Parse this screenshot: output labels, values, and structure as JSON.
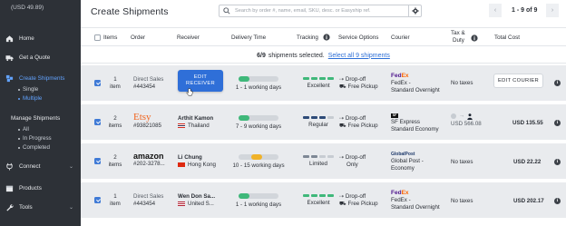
{
  "sidebar": {
    "balance": "(USD 49.89)",
    "items": [
      {
        "label": "Home"
      },
      {
        "label": "Get a Quote"
      },
      {
        "label": "Create Shipments"
      },
      {
        "label": "Manage Shipments"
      },
      {
        "label": "Connect"
      },
      {
        "label": "Products"
      },
      {
        "label": "Tools"
      }
    ],
    "create_sub": [
      "Single",
      "Multiple"
    ],
    "manage_sub": [
      "All",
      "In Progress",
      "Completed"
    ]
  },
  "header": {
    "title": "Create Shipments",
    "search_placeholder": "Search by order #, name, email, SKU, desc. or Easyship ref.",
    "pagination": "1 - 9 of 9",
    "prev": "‹",
    "next": "›"
  },
  "table": {
    "columns": [
      "Items",
      "Order",
      "Receiver",
      "Delivery Time",
      "Tracking",
      "Service Options",
      "Courier",
      "Tax &",
      "Duty",
      "Total Cost"
    ]
  },
  "selection": {
    "count": "6/9",
    "text": "shipments selected.",
    "link": "Select all 9 shipments"
  },
  "colors": {
    "accent": "#2f6fd8",
    "progress_green": "#3fb87a",
    "progress_orange": "#f0b229",
    "tracking_excellent": "#3fb87a",
    "tracking_regular": "#2e4b78",
    "tracking_limited": "#7e8895",
    "tracking_off": "#c7ccd2"
  },
  "rows": [
    {
      "checked": true,
      "items_num": "1",
      "items_word": "item",
      "store": "Direct Sales",
      "order_no": "#443454",
      "receiver_button": [
        "EDIT",
        "RECEIVER"
      ],
      "delivery_progress": 0.27,
      "delivery_color": "#3fb87a",
      "delivery_text": "1 - 1 working days",
      "tracking_level": 4,
      "tracking_color": "#3fb87a",
      "tracking_text": "Excellent",
      "service_1": "Drop-off",
      "service_2": "Free Pickup",
      "courier_logo": "FedEx",
      "courier_line1": "FedEx -",
      "courier_line2": "Standard Overnight",
      "tax": "No taxes",
      "action_label": "EDIT COURIER"
    },
    {
      "checked": true,
      "items_num": "2",
      "items_word": "items",
      "store": "Etsy",
      "order_no": "#93821085",
      "receiver_name": "Arthit Kamon",
      "receiver_country": "Thailand",
      "delivery_progress": 0.27,
      "delivery_color": "#3fb87a",
      "delivery_text": "7 - 9 working days",
      "tracking_level": 3,
      "tracking_color": "#2e4b78",
      "tracking_text": "Regular",
      "service_1": "Drop-off",
      "service_2": "Free Pickup",
      "courier_logo": "SF",
      "courier_line1": "SF Express",
      "courier_line2": "Standard Economy",
      "tax_amount": "USD 566.08",
      "cost": "USD 135.55"
    },
    {
      "checked": true,
      "items_num": "2",
      "items_word": "items",
      "store": "amazon",
      "order_no": "#202-3278...",
      "receiver_name": "Li Chung",
      "receiver_country": "Hong Kong",
      "delivery_progress": 0.27,
      "delivery_color": "#f0b229",
      "delivery_text": "10 - 15 working days",
      "tracking_level": 2,
      "tracking_color": "#7e8895",
      "tracking_text": "Limited",
      "service_1": "Drop-off",
      "service_2": "Only",
      "courier_logo": "GlobalPost",
      "courier_line1": "Global Post -",
      "courier_line2": "Economy",
      "tax": "No taxes",
      "cost": "USD 22.22"
    },
    {
      "checked": true,
      "items_num": "1",
      "items_word": "item",
      "store": "Direct Sales",
      "order_no": "#443454",
      "receiver_name": "Wen Don Sa...",
      "receiver_country": "United S...",
      "delivery_progress": 0.27,
      "delivery_color": "#3fb87a",
      "delivery_text": "1 - 1 working days",
      "tracking_level": 4,
      "tracking_color": "#3fb87a",
      "tracking_text": "Excellent",
      "service_1": "Drop-off",
      "service_2": "Free Pickup",
      "courier_logo": "FedEx",
      "courier_line1": "FedEx -",
      "courier_line2": "Standard Overnight",
      "tax": "No taxes",
      "cost": "USD 202.17"
    }
  ]
}
